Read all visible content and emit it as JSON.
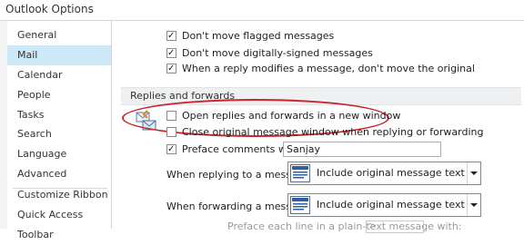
{
  "window": {
    "title": "Outlook Options"
  },
  "sidebar": {
    "items": [
      {
        "label": "General"
      },
      {
        "label": "Mail"
      },
      {
        "label": "Calendar"
      },
      {
        "label": "People"
      },
      {
        "label": "Tasks"
      },
      {
        "label": "Search"
      },
      {
        "label": "Language"
      },
      {
        "label": "Advanced"
      },
      {
        "label": "Customize Ribbon"
      },
      {
        "label": "Quick Access Toolbar"
      }
    ],
    "selected": "Mail"
  },
  "options_top": [
    {
      "label": "Don't move flagged messages",
      "checked": true
    },
    {
      "label": "Don't move digitally-signed messages",
      "checked": true
    },
    {
      "label": "When a reply modifies a message, don't move the original",
      "checked": true
    }
  ],
  "replies_section": {
    "heading": "Replies and forwards",
    "open_new_window": {
      "label": "Open replies and forwards in a new window",
      "checked": false
    },
    "close_original": {
      "label": "Close original message window when replying or forwarding",
      "checked": false
    },
    "preface": {
      "label": "Preface comments with:",
      "checked": true,
      "value": "Sanjay"
    },
    "replying": {
      "label": "When replying to a message:",
      "value": "Include original message text"
    },
    "forwarding": {
      "label": "When forwarding a message:",
      "value": "Include original message text"
    },
    "prefix_line": {
      "label": "Preface each line in a plain-text message with:",
      "value": ">"
    }
  },
  "colors": {
    "selected_bg": "#cde8f6",
    "highlight_ellipse": "#c8252c",
    "section_bg": "#eef0f2"
  },
  "icons": [
    "reply-forward-icon",
    "message-format-icon",
    "checkmark-icon",
    "dropdown-arrow-icon"
  ]
}
